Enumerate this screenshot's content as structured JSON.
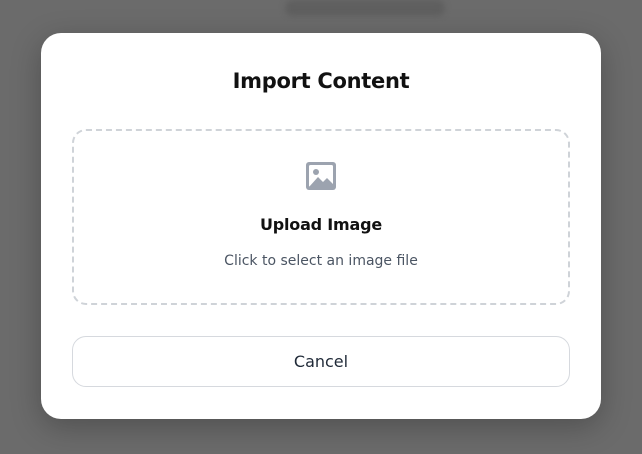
{
  "modal": {
    "title": "Import Content",
    "dropzone": {
      "icon": "image-icon",
      "title": "Upload Image",
      "subtitle": "Click to select an image file"
    },
    "cancel_label": "Cancel"
  },
  "colors": {
    "overlay": "#6b6b6b",
    "modal_bg": "#ffffff",
    "dashed_border": "#cfd3d8",
    "icon": "#9ca3af",
    "title_text": "#111111",
    "subtitle_text": "#4b5563"
  }
}
